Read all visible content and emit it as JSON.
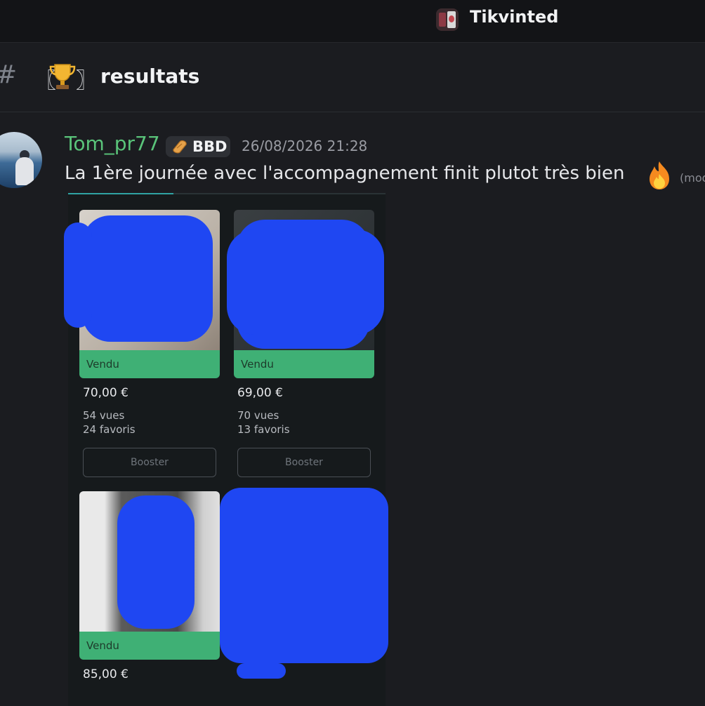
{
  "server": {
    "name": "Tikvinted"
  },
  "channel": {
    "bracket_left": "〖",
    "bracket_right": "〗",
    "name": "resultats",
    "hash": "#"
  },
  "message": {
    "username": "Tom_pr77",
    "badge": "BBD",
    "timestamp": "26/08/2026 21:28",
    "text": "La 1ère journée avec l'accompagnement finit plutot très bien",
    "edited": "(mod"
  },
  "listings": [
    {
      "status": "Vendu",
      "price": "70,00 €",
      "views": "54 vues",
      "favorites": "24 favoris",
      "button": "Booster"
    },
    {
      "status": "Vendu",
      "price": "69,00 €",
      "views": "70 vues",
      "favorites": "13 favoris",
      "button": "Booster"
    },
    {
      "status": "Vendu",
      "price": "85,00 €"
    },
    {
      "status": ""
    }
  ],
  "colors": {
    "accent_green": "#3fb075",
    "scribble_blue": "#1f47f2",
    "username_green": "#5ac47a"
  }
}
